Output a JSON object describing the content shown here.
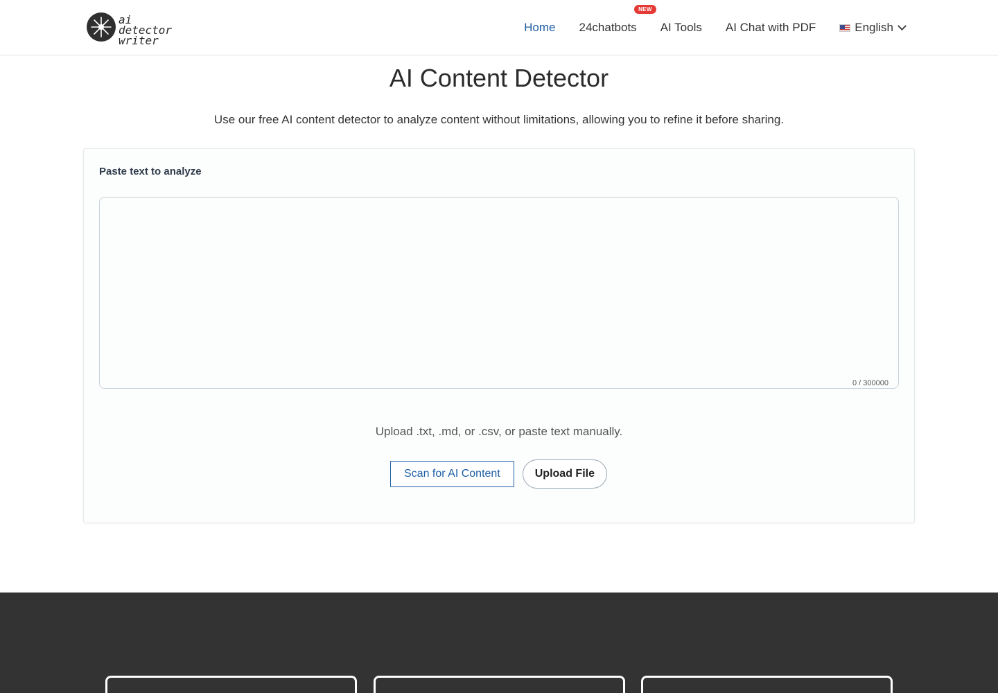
{
  "header": {
    "logo": {
      "line1": "ai detector",
      "line2": "writer"
    },
    "nav": [
      {
        "label": "Home",
        "active": true
      },
      {
        "label": "24chatbots",
        "badge": "NEW"
      },
      {
        "label": "AI Tools"
      },
      {
        "label": "AI Chat with PDF"
      }
    ],
    "language": {
      "label": "English",
      "flag": "us-flag-icon"
    }
  },
  "main": {
    "title": "AI Content Detector",
    "subtitle": "Use our free AI content detector to analyze content without limitations, allowing you to refine it before sharing.",
    "card": {
      "label": "Paste text to analyze",
      "textarea_value": "",
      "counter": "0 / 300000",
      "upload_hint": "Upload .txt, .md, or .csv, or paste text manually.",
      "scan_button": "Scan for AI Content",
      "upload_button": "Upload File"
    }
  },
  "colors": {
    "accent": "#1f5fa6",
    "badge": "#e53935",
    "footer_bg": "#333333"
  }
}
